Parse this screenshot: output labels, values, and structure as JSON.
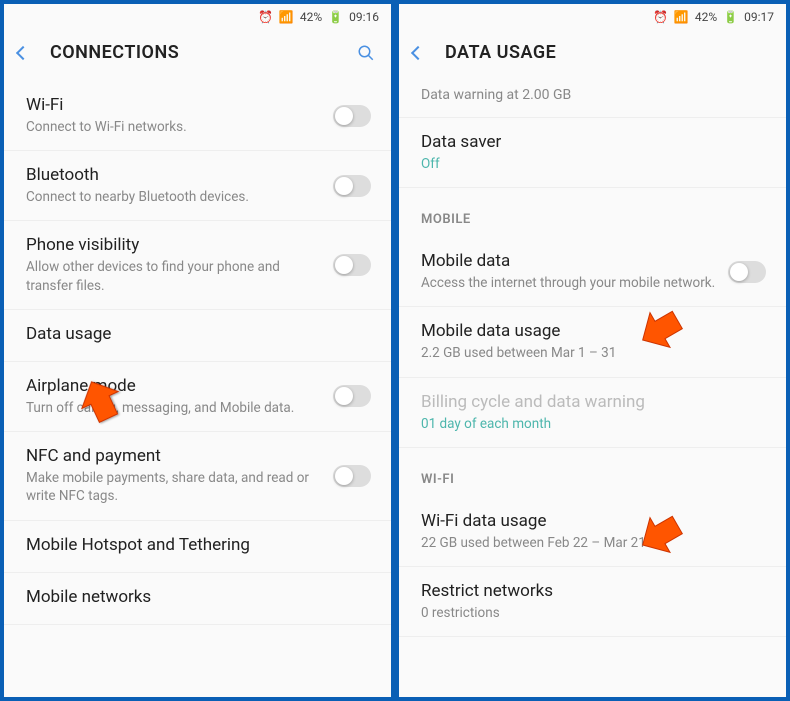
{
  "left": {
    "status": {
      "battery": "42%",
      "time": "09:16"
    },
    "title": "CONNECTIONS",
    "items": [
      {
        "title": "Wi-Fi",
        "sub": "Connect to Wi-Fi networks.",
        "toggle": true
      },
      {
        "title": "Bluetooth",
        "sub": "Connect to nearby Bluetooth devices.",
        "toggle": true
      },
      {
        "title": "Phone visibility",
        "sub": "Allow other devices to find your phone and transfer files.",
        "toggle": true
      },
      {
        "title": "Data usage",
        "sub": "",
        "toggle": false
      },
      {
        "title": "Airplane mode",
        "sub": "Turn off calling, messaging, and Mobile data.",
        "toggle": true
      },
      {
        "title": "NFC and payment",
        "sub": "Make mobile payments, share data, and read or write NFC tags.",
        "toggle": true
      },
      {
        "title": "Mobile Hotspot and Tethering",
        "sub": "",
        "toggle": false
      },
      {
        "title": "Mobile networks",
        "sub": "",
        "toggle": false
      }
    ]
  },
  "right": {
    "status": {
      "battery": "42%",
      "time": "09:17"
    },
    "title": "DATA USAGE",
    "top_sub": "Data warning at 2.00 GB",
    "data_saver": {
      "title": "Data saver",
      "value": "Off"
    },
    "sections": {
      "mobile": {
        "header": "MOBILE",
        "items": [
          {
            "title": "Mobile data",
            "sub": "Access the internet through your mobile network.",
            "toggle": true
          },
          {
            "title": "Mobile data usage",
            "sub": "2.2 GB used between Mar 1 – 31",
            "toggle": false
          },
          {
            "title": "Billing cycle and data warning",
            "sub": "01 day of each month",
            "toggle": false,
            "accent": true
          }
        ]
      },
      "wifi": {
        "header": "WI-FI",
        "items": [
          {
            "title": "Wi-Fi data usage",
            "sub": "22 GB used between Feb 22 – Mar 21",
            "toggle": false
          },
          {
            "title": "Restrict networks",
            "sub": "0 restrictions",
            "toggle": false
          }
        ]
      }
    }
  }
}
